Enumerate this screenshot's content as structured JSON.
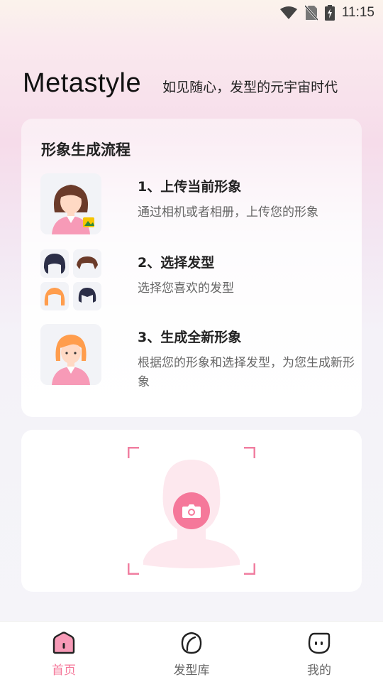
{
  "status_bar": {
    "time": "11:15",
    "icons": [
      "wifi-icon",
      "no-sim-icon",
      "battery-charging-icon"
    ]
  },
  "header": {
    "brand": "Metastyle",
    "slogan": "如见随心，发型的元宇宙时代"
  },
  "process_card": {
    "title": "形象生成流程",
    "steps": [
      {
        "title": "1、上传当前形象",
        "desc": "通过相机或者相册，上传您的形象",
        "icon": "woman-avatar-icon"
      },
      {
        "title": "2、选择发型",
        "desc": "选择您喜欢的发型",
        "icon": "hairstyle-grid-icon"
      },
      {
        "title": "3、生成全新形象",
        "desc": "根据您的形象和选择发型，为您生成新形象",
        "icon": "new-avatar-icon"
      }
    ]
  },
  "upload_card": {
    "icon": "camera-icon"
  },
  "tabbar": {
    "items": [
      {
        "label": "首页",
        "icon": "home-icon",
        "active": true
      },
      {
        "label": "发型库",
        "icon": "hair-library-icon",
        "active": false
      },
      {
        "label": "我的",
        "icon": "profile-face-icon",
        "active": false
      }
    ]
  },
  "colors": {
    "accent": "#f5789a",
    "text_primary": "#222222",
    "text_secondary": "#666666"
  }
}
